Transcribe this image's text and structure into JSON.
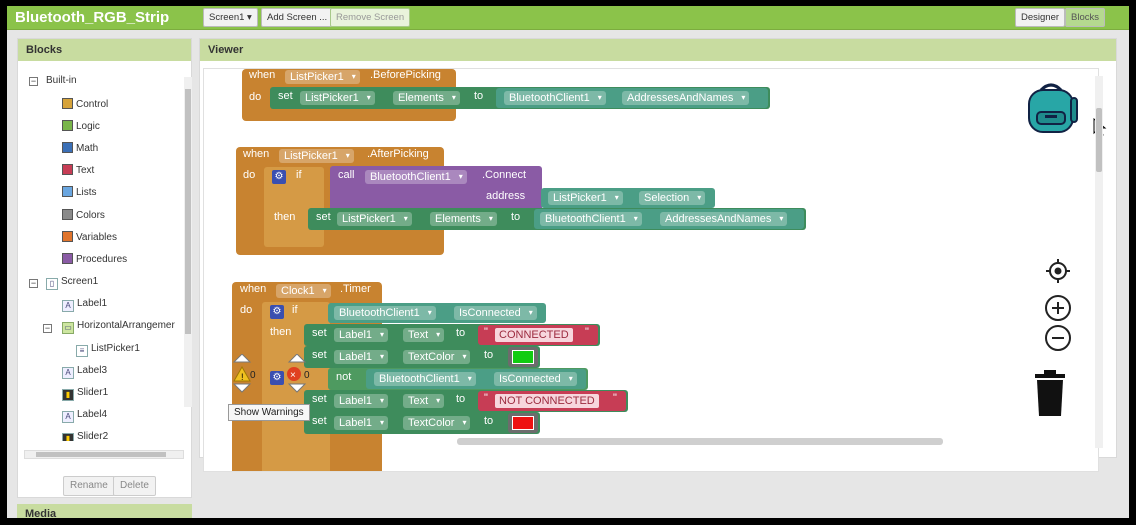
{
  "app": {
    "title": "Bluetooth_RGB_Strip"
  },
  "toolbar": {
    "screen_select": "Screen1 ▾",
    "add_screen": "Add Screen ...",
    "remove_screen": "Remove Screen",
    "designer": "Designer",
    "blocks": "Blocks"
  },
  "blocks_panel": {
    "title": "Blocks",
    "builtin": "Built-in",
    "builtin_items": [
      {
        "label": "Control",
        "color": "#d6a33a"
      },
      {
        "label": "Logic",
        "color": "#79b54a"
      },
      {
        "label": "Math",
        "color": "#3b6fb6"
      },
      {
        "label": "Text",
        "color": "#c73d55"
      },
      {
        "label": "Lists",
        "color": "#6aa6e0"
      },
      {
        "label": "Colors",
        "color": "#8a8a8a"
      },
      {
        "label": "Variables",
        "color": "#e0742c"
      },
      {
        "label": "Procedures",
        "color": "#8a5ba5"
      }
    ],
    "screen": "Screen1",
    "components": [
      "Label1",
      "HorizontalArrangemer",
      "ListPicker1",
      "Label3",
      "Slider1",
      "Label4",
      "Slider2"
    ],
    "rename": "Rename",
    "delete": "Delete",
    "media": "Media"
  },
  "viewer": {
    "title": "Viewer",
    "tooltip": "Show Warnings",
    "warnings": "0",
    "errors": "0"
  },
  "blocks": {
    "b1": {
      "when": "when",
      "comp": "ListPicker1",
      "event": ".BeforePicking",
      "do": "do",
      "set": "set",
      "setcomp": "ListPicker1",
      "prop": "Elements",
      "to": "to",
      "src": "BluetoothClient1",
      "srcprop": "AddressesAndNames"
    },
    "b2": {
      "when": "when",
      "comp": "ListPicker1",
      "event": ".AfterPicking",
      "do": "do",
      "if": "if",
      "call": "call",
      "callcomp": "BluetoothClient1",
      "method": ".Connect",
      "address": "address",
      "addrcomp": "ListPicker1",
      "addrprop": "Selection",
      "then": "then",
      "set": "set",
      "setcomp": "ListPicker1",
      "prop": "Elements",
      "to": "to",
      "src": "BluetoothClient1",
      "srcprop": "AddressesAndNames"
    },
    "b3": {
      "when": "when",
      "comp": "Clock1",
      "event": ".Timer",
      "do": "do",
      "if": "if",
      "cond": "BluetoothClient1",
      "condprop": "IsConnected",
      "then": "then",
      "set": "set",
      "lbl": "Label1",
      "textprop": "Text",
      "to": "to",
      "connected": "CONNECTED",
      "colorprop": "TextColor",
      "not": "not",
      "notcomp": "BluetoothClient1",
      "notprop": "IsConnected",
      "notconnected": "NOT CONNECTED",
      "quote": "\""
    }
  },
  "colors": {
    "topbar": "#8bc34a",
    "green_swatch": "#11cc11",
    "red_swatch": "#ee1111"
  }
}
